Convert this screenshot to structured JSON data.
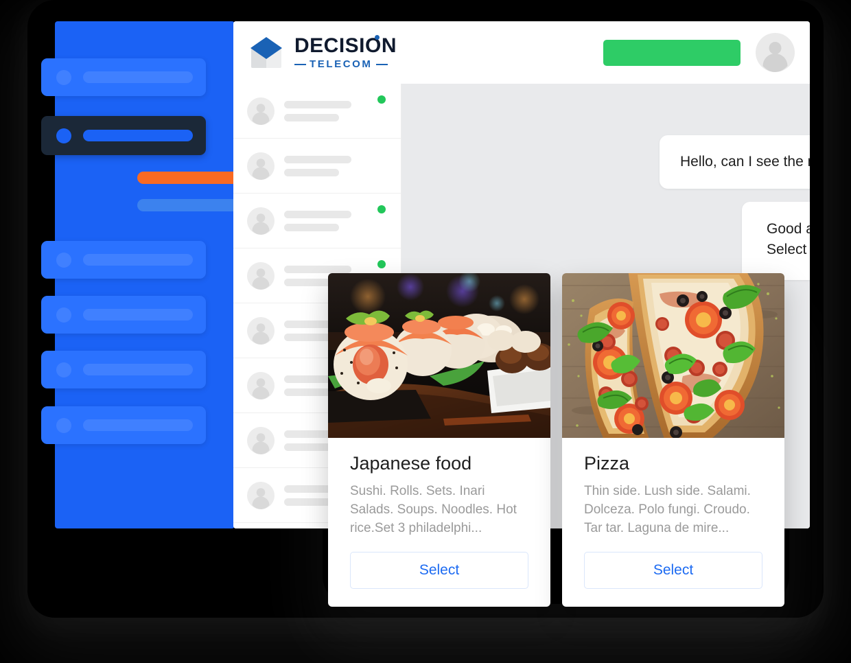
{
  "brand": {
    "logo_icon": "cube-logo-icon",
    "name_top": "DECISION",
    "name_bottom": "TELECOM",
    "navy": "#101A2E",
    "blue": "#1A62B5"
  },
  "topbar": {
    "action_button_label": "",
    "action_button_color": "#2ECC66",
    "avatar_icon": "user-avatar-icon"
  },
  "sidebar": {
    "background": "#1B62F5",
    "items": [
      {
        "name": "sidebar-item-1",
        "type": "wide",
        "icon": "placeholder-dot-icon",
        "label": ""
      },
      {
        "name": "sidebar-item-2",
        "type": "active",
        "icon": "placeholder-dot-icon",
        "label": ""
      },
      {
        "name": "sidebar-item-3",
        "type": "plain-orange",
        "label": ""
      },
      {
        "name": "sidebar-item-4",
        "type": "plain-light",
        "label": ""
      },
      {
        "name": "sidebar-item-5",
        "type": "wide",
        "icon": "placeholder-dot-icon",
        "label": ""
      },
      {
        "name": "sidebar-item-6",
        "type": "wide",
        "icon": "placeholder-dot-icon",
        "label": ""
      },
      {
        "name": "sidebar-item-7",
        "type": "wide",
        "icon": "placeholder-dot-icon",
        "label": ""
      },
      {
        "name": "sidebar-item-8",
        "type": "wide",
        "icon": "placeholder-dot-icon",
        "label": ""
      }
    ],
    "accent_orange": "#F96A22",
    "accent_light": "#3C82EE",
    "active_background": "#1B2838"
  },
  "contacts": {
    "online_color": "#22C75A",
    "rows": [
      {
        "avatar_icon": "user-avatar-icon",
        "name": "",
        "preview": "",
        "online": true
      },
      {
        "avatar_icon": "user-avatar-icon",
        "name": "",
        "preview": "",
        "online": false
      },
      {
        "avatar_icon": "user-avatar-icon",
        "name": "",
        "preview": "",
        "online": true
      },
      {
        "avatar_icon": "user-avatar-icon",
        "name": "",
        "preview": "",
        "online": true
      },
      {
        "avatar_icon": "user-avatar-icon",
        "name": "",
        "preview": "",
        "online": false
      },
      {
        "avatar_icon": "user-avatar-icon",
        "name": "",
        "preview": "",
        "online": false
      },
      {
        "avatar_icon": "user-avatar-icon",
        "name": "",
        "preview": "",
        "online": false
      },
      {
        "avatar_icon": "user-avatar-icon",
        "name": "",
        "preview": "",
        "online": false
      }
    ]
  },
  "chat": {
    "background": "#E9EAEC",
    "messages": [
      {
        "id": "msg-incoming",
        "from": "customer",
        "text": "Hello, can I see the menu?"
      },
      {
        "id": "msg-outgoing",
        "from": "agent",
        "text": "Good afternoon, of course.\nSelect category:"
      }
    ]
  },
  "cards": [
    {
      "id": "card-japanese-food",
      "image_alt": "sushi-rolls-photo",
      "title": "Japanese food",
      "description": "Sushi. Rolls. Sets. Inari Salads. Soups. Noodles. Hot rice.Set 3 philadelphi...",
      "button_label": "Select",
      "button_color": "#1D6BF2"
    },
    {
      "id": "card-pizza",
      "image_alt": "pizza-slices-photo",
      "title": "Pizza",
      "description": "Thin side. Lush side. Salami. Dolceza. Polo fungi. Croudo. Tar tar. Laguna de mire...",
      "button_label": "Select",
      "button_color": "#1D6BF2"
    }
  ]
}
